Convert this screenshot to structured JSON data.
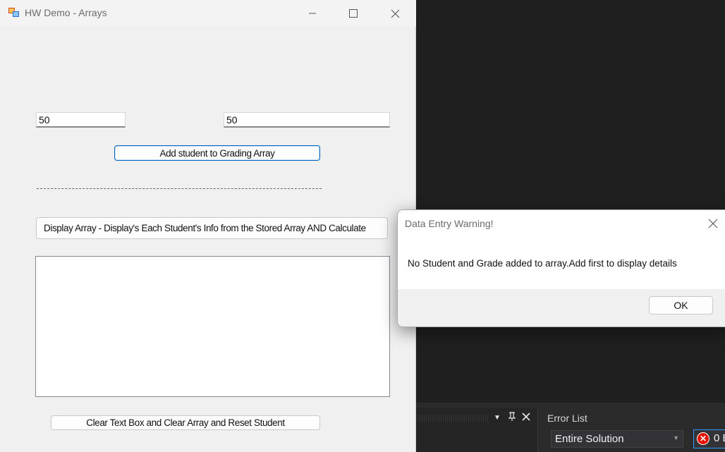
{
  "window": {
    "title": "HW Demo - Arrays",
    "student_input_value": "50",
    "grade_input_value": "50",
    "add_button_label": "Add student to Grading Array",
    "separator_text": "------------------------------------------------------------------------------------------------------------",
    "display_button_label": "Display Array - Display's Each Student's Info from the Stored Array AND Calculate",
    "clear_button_label": "Clear Text Box and Clear Array and Reset Student",
    "icons": {
      "app": "app-icon",
      "minimize": "minimize-icon",
      "maximize": "maximize-icon",
      "close": "close-icon"
    }
  },
  "dialog": {
    "title": "Data Entry Warning!",
    "message": "No Student and Grade added to array.Add first to display details",
    "ok_label": "OK"
  },
  "vs": {
    "error_list_title": "Error List",
    "scope_value": "Entire Solution",
    "error_count_text": "0 E",
    "icons": {
      "dropdown": "chevron-down-icon",
      "pin": "pin-icon",
      "close": "close-icon",
      "error": "error-icon"
    }
  },
  "colors": {
    "accent": "#0067c0",
    "vs_background": "#1f1f1f",
    "error_red": "#e51400"
  }
}
